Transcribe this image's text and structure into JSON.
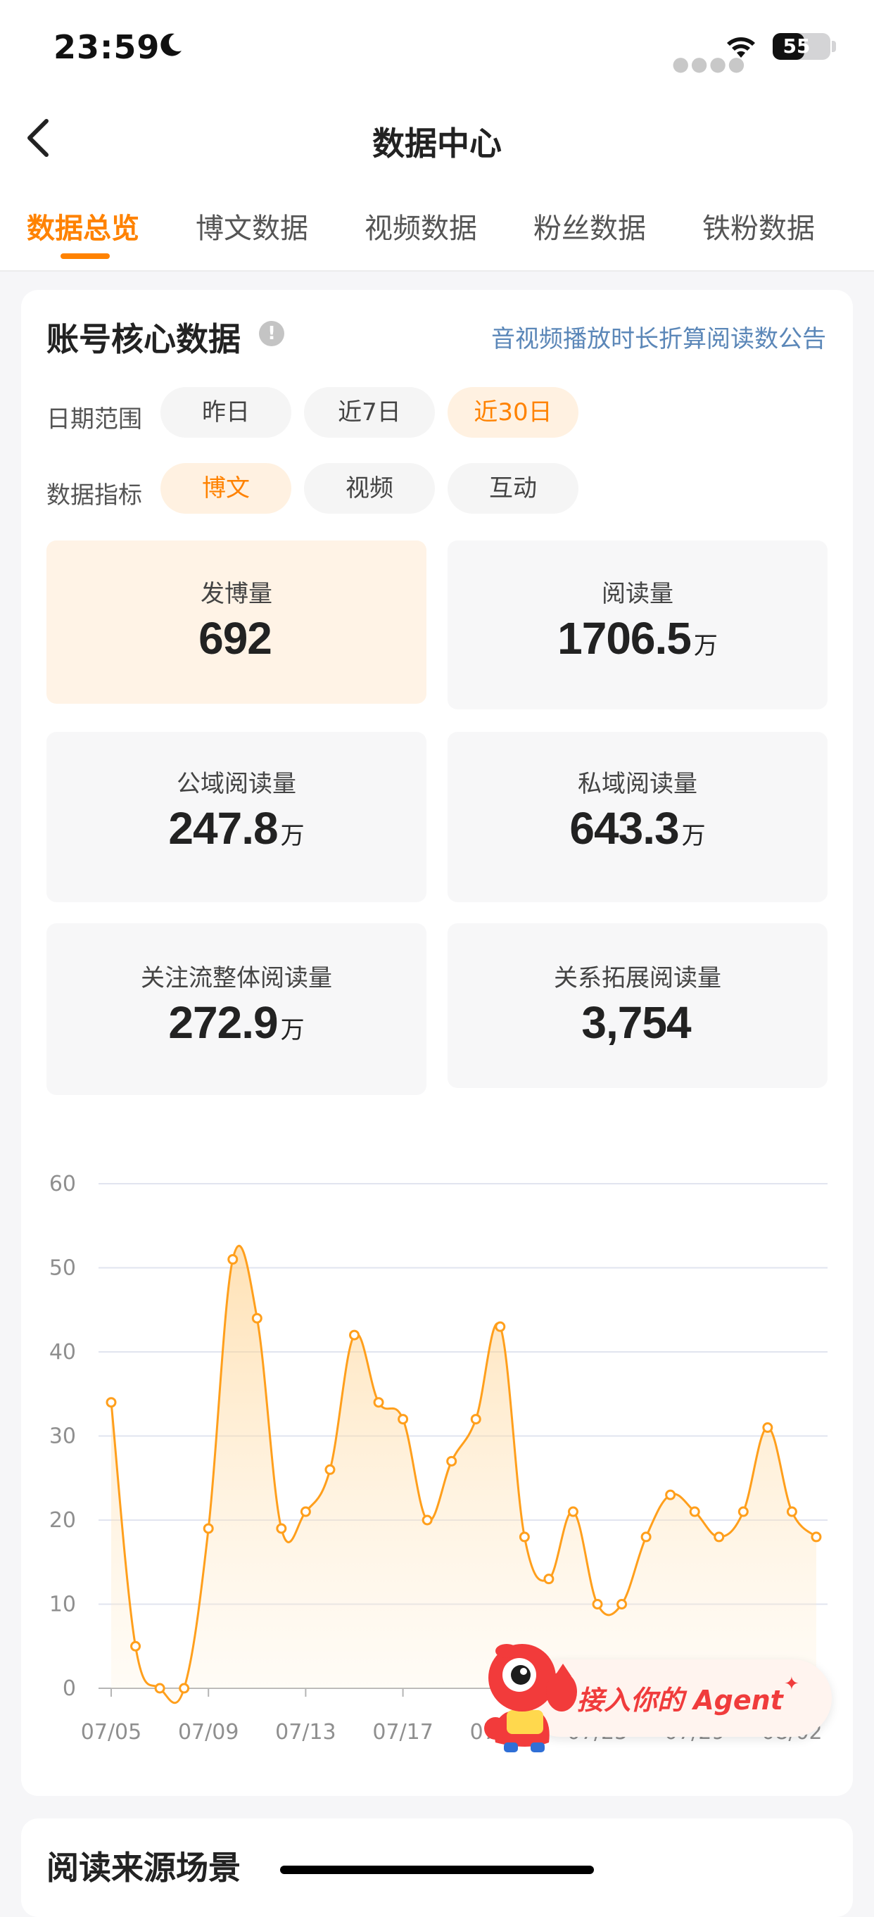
{
  "status_bar": {
    "time": "23:59",
    "battery": "55",
    "battery_level": 0.55
  },
  "nav": {
    "title": "数据中心"
  },
  "tabs": [
    {
      "label": "数据总览",
      "active": true
    },
    {
      "label": "博文数据",
      "active": false
    },
    {
      "label": "视频数据",
      "active": false
    },
    {
      "label": "粉丝数据",
      "active": false
    },
    {
      "label": "铁粉数据",
      "active": false
    }
  ],
  "core": {
    "title": "账号核心数据",
    "info_icon": "!",
    "notice_link": "音视频播放时长折算阅读数公告"
  },
  "filters": {
    "date_label": "日期范围",
    "date_options": [
      "昨日",
      "近7日",
      "近30日"
    ],
    "date_selected": 2,
    "metric_label": "数据指标",
    "metric_options": [
      "博文",
      "视频",
      "互动"
    ],
    "metric_selected": 0
  },
  "stats": [
    {
      "label": "发博量",
      "value": "692",
      "unit": ""
    },
    {
      "label": "阅读量",
      "value": "1706.5",
      "unit": "万"
    },
    {
      "label": "公域阅读量",
      "value": "247.8",
      "unit": "万"
    },
    {
      "label": "私域阅读量",
      "value": "643.3",
      "unit": "万"
    },
    {
      "label": "关注流整体阅读量",
      "value": "272.9",
      "unit": "万"
    },
    {
      "label": "关系拓展阅读量",
      "value": "3,754",
      "unit": ""
    }
  ],
  "chart_data": {
    "type": "area",
    "title": "",
    "xlabel": "",
    "ylabel": "",
    "ylim": [
      0,
      60
    ],
    "yticks": [
      0,
      10,
      20,
      30,
      40,
      50,
      60
    ],
    "xtick_labels": [
      "07/05",
      "07/09",
      "07/13",
      "07/17",
      "07/21",
      "07/25",
      "07/29",
      "08/02"
    ],
    "x": [
      "07/05",
      "07/06",
      "07/07",
      "07/08",
      "07/09",
      "07/10",
      "07/11",
      "07/12",
      "07/13",
      "07/14",
      "07/15",
      "07/16",
      "07/17",
      "07/18",
      "07/19",
      "07/20",
      "07/21",
      "07/22",
      "07/23",
      "07/24",
      "07/25",
      "07/26",
      "07/27",
      "07/28",
      "07/29",
      "07/30",
      "07/31",
      "08/01",
      "08/02",
      "08/03"
    ],
    "series": [
      {
        "values": [
          34,
          5,
          0,
          0,
          19,
          51,
          44,
          19,
          21,
          26,
          42,
          34,
          32,
          20,
          27,
          32,
          43,
          18,
          13,
          21,
          10,
          10,
          18,
          23,
          21,
          18,
          21,
          31,
          21,
          18
        ]
      }
    ],
    "grid": true,
    "color": "#ff9f1c"
  },
  "agent_banner": {
    "text": "接入你的 Agent",
    "sparkle": "✦"
  },
  "bottom": {
    "section_title": "阅读来源场景"
  }
}
